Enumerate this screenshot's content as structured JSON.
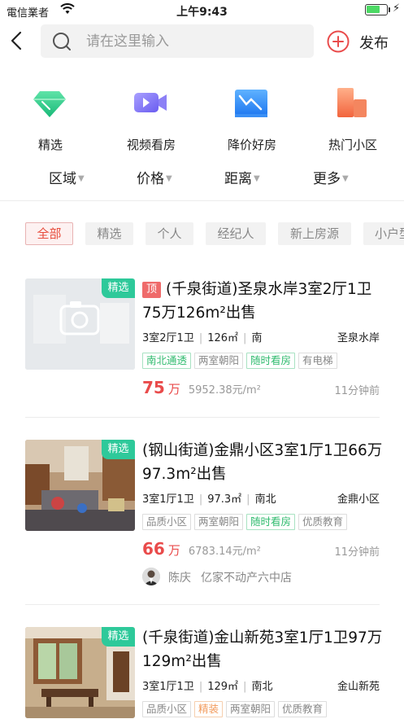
{
  "status_bar": {
    "carrier": "電信業者",
    "time": "上午9:43"
  },
  "search": {
    "placeholder": "请在这里输入",
    "publish_label": "发布"
  },
  "categories": [
    {
      "label": "精选",
      "icon": "diamond-icon"
    },
    {
      "label": "视频看房",
      "icon": "video-camera-icon"
    },
    {
      "label": "降价好房",
      "icon": "price-drop-chart-icon"
    },
    {
      "label": "热门小区",
      "icon": "buildings-icon"
    }
  ],
  "filters": [
    {
      "label": "区域"
    },
    {
      "label": "价格"
    },
    {
      "label": "距离"
    },
    {
      "label": "更多"
    }
  ],
  "chips": [
    "全部",
    "精选",
    "个人",
    "经纪人",
    "新上房源",
    "小户型"
  ],
  "colors": {
    "accent_red": "#e94b4b",
    "badge_green": "#2ec99a",
    "tag_green": "#2fbb6e",
    "tag_orange": "#f29b5c"
  },
  "listings": [
    {
      "badge": "精选",
      "top_tag": "顶",
      "title": "(千泉街道)圣泉水岸3室2厅1卫75万126m²出售",
      "layout": "3室2厅1卫",
      "area": "126㎡",
      "orientation": "南",
      "community": "圣泉水岸",
      "tags": [
        {
          "text": "南北通透",
          "style": "green"
        },
        {
          "text": "两室朝阳",
          "style": "gray"
        },
        {
          "text": "随时看房",
          "style": "green"
        },
        {
          "text": "有电梯",
          "style": "gray"
        }
      ],
      "price": "75",
      "price_unit": "万",
      "unit_price": "5952.38元/m²",
      "time_ago": "11分钟前",
      "thumbnail": "placeholder-no-photo"
    },
    {
      "badge": "精选",
      "title": "(钢山街道)金鼎小区3室1厅1卫66万97.3m²出售",
      "layout": "3室1厅1卫",
      "area": "97.3㎡",
      "orientation": "南北",
      "community": "金鼎小区",
      "tags": [
        {
          "text": "品质小区",
          "style": "gray"
        },
        {
          "text": "两室朝阳",
          "style": "gray"
        },
        {
          "text": "随时看房",
          "style": "green"
        },
        {
          "text": "优质教育",
          "style": "gray"
        }
      ],
      "price": "66",
      "price_unit": "万",
      "unit_price": "6783.14元/m²",
      "time_ago": "11分钟前",
      "agent_name": "陈庆",
      "agent_shop": "亿家不动产六中店",
      "thumbnail": "living-room-photo"
    },
    {
      "badge": "精选",
      "title": "(千泉街道)金山新苑3室1厅1卫97万129m²出售",
      "layout": "3室1厅1卫",
      "area": "129㎡",
      "orientation": "南北",
      "community": "金山新苑",
      "tags": [
        {
          "text": "品质小区",
          "style": "gray"
        },
        {
          "text": "精装",
          "style": "orange"
        },
        {
          "text": "两室朝阳",
          "style": "gray"
        },
        {
          "text": "优质教育",
          "style": "gray"
        }
      ],
      "thumbnail": "dining-room-photo"
    }
  ]
}
